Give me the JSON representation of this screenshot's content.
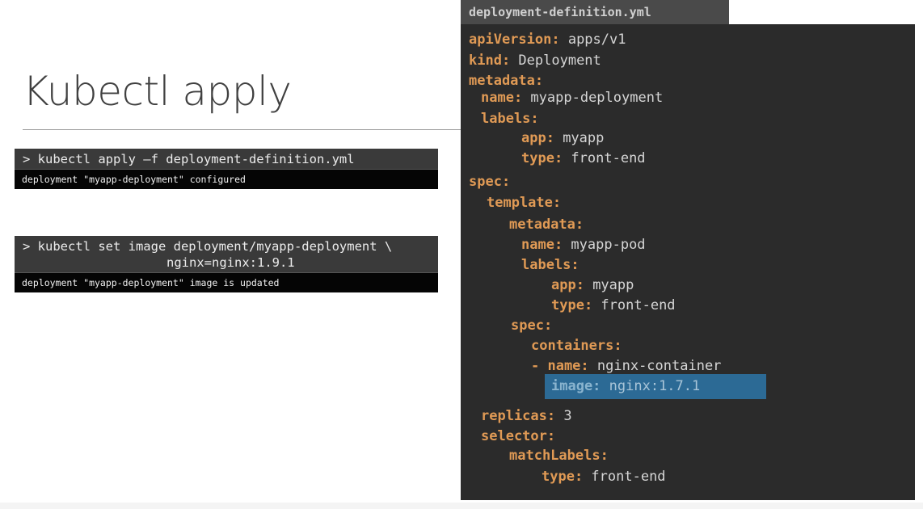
{
  "slide": {
    "title": "Kubectl apply"
  },
  "terminal_1": {
    "command": "> kubectl apply –f deployment-definition.yml",
    "output": "deployment \"myapp-deployment\" configured"
  },
  "terminal_2": {
    "command_line1": "> kubectl set image deployment/myapp-deployment \\",
    "command_line2": "nginx=nginx:1.9.1",
    "output": "deployment \"myapp-deployment\" image is updated"
  },
  "editor": {
    "filename": "deployment-definition.yml",
    "lines": [
      {
        "key": "apiVersion:",
        "value": " apps/v1"
      },
      {
        "key": "kind:",
        "value": " Deployment"
      },
      {
        "key": "metadata:",
        "value": ""
      },
      {
        "key": "name:",
        "value": " myapp-deployment"
      },
      {
        "key": "labels:",
        "value": ""
      },
      {
        "key": "app:",
        "value": " myapp"
      },
      {
        "key": "type:",
        "value": " front-end"
      },
      {
        "key": "spec:",
        "value": ""
      },
      {
        "key": "template:",
        "value": ""
      },
      {
        "key": "metadata:",
        "value": ""
      },
      {
        "key": "name:",
        "value": " myapp-pod"
      },
      {
        "key": "labels:",
        "value": ""
      },
      {
        "key": "app:",
        "value": " myapp"
      },
      {
        "key": "type:",
        "value": " front-end"
      },
      {
        "key": "spec:",
        "value": ""
      },
      {
        "key": "containers:",
        "value": ""
      },
      {
        "key": "- name:",
        "value": " nginx-container"
      },
      {
        "key": "image:",
        "value": " nginx:1.7.1"
      },
      {
        "key": "replicas:",
        "value": " 3"
      },
      {
        "key": "selector:",
        "value": ""
      },
      {
        "key": "matchLabels:",
        "value": ""
      },
      {
        "key": "type:",
        "value": " front-end"
      }
    ]
  },
  "colors": {
    "yaml_key": "#e09a55",
    "yaml_value": "#d6d6d6",
    "editor_bg": "#2b2b2b",
    "highlight": "#2c6a95"
  }
}
